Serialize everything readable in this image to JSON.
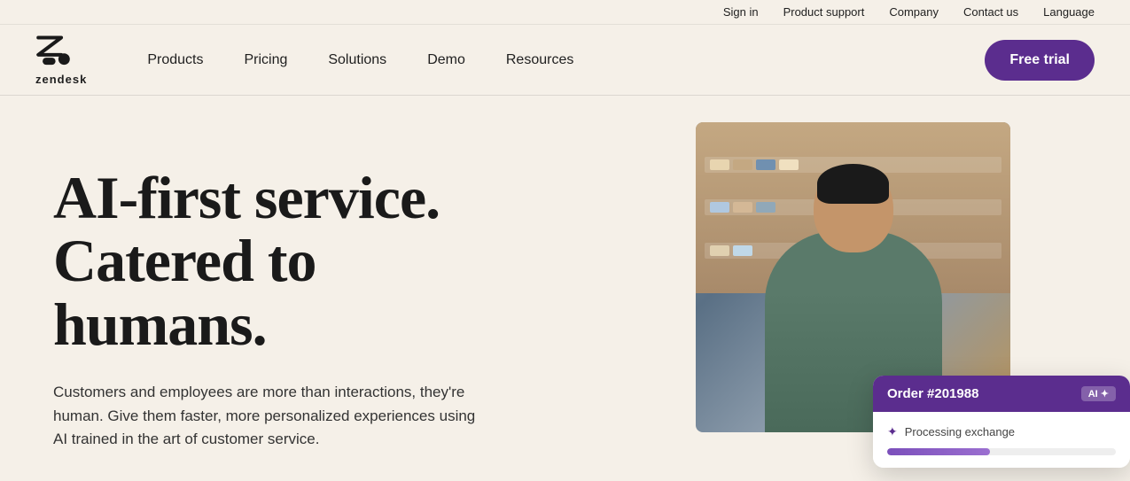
{
  "topbar": {
    "links": [
      {
        "label": "Sign in",
        "id": "signin"
      },
      {
        "label": "Product support",
        "id": "product-support"
      },
      {
        "label": "Company",
        "id": "company"
      },
      {
        "label": "Contact us",
        "id": "contact"
      },
      {
        "label": "Language",
        "id": "language"
      }
    ]
  },
  "nav": {
    "logo_text": "zendesk",
    "links": [
      {
        "label": "Products",
        "id": "products"
      },
      {
        "label": "Pricing",
        "id": "pricing"
      },
      {
        "label": "Solutions",
        "id": "solutions"
      },
      {
        "label": "Demo",
        "id": "demo"
      },
      {
        "label": "Resources",
        "id": "resources"
      }
    ],
    "cta": "Free trial"
  },
  "hero": {
    "heading_line1": "AI-first service.",
    "heading_line2": "Catered to",
    "heading_line3": "humans.",
    "subtext": "Customers and employees are more than interactions, they're human. Give them faster, more personalized experiences using AI trained in the art of customer service.",
    "widget": {
      "order": "Order #201988",
      "ai_label": "AI ✦",
      "processing": "Processing exchange"
    }
  },
  "colors": {
    "accent": "#5b2d8e",
    "bg": "#f5f0e8",
    "text_dark": "#1a1a1a",
    "text_body": "#333333"
  }
}
